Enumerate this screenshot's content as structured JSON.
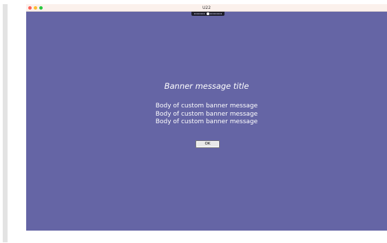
{
  "window": {
    "title": "U22"
  },
  "banner": {
    "title": "Banner message title",
    "body_lines": [
      "Body of custom banner message",
      "Body of custom banner message",
      "Body of custom banner message"
    ],
    "ok_label": "OK"
  },
  "colors": {
    "banner_background": "#6565a5",
    "titlebar_background": "#fbf1ec",
    "text": "#ffffff"
  },
  "icons": {
    "close": "close-icon",
    "minimize": "minimize-icon",
    "maximize": "maximize-icon",
    "toolbar_handle": "drag-handle-icon"
  }
}
